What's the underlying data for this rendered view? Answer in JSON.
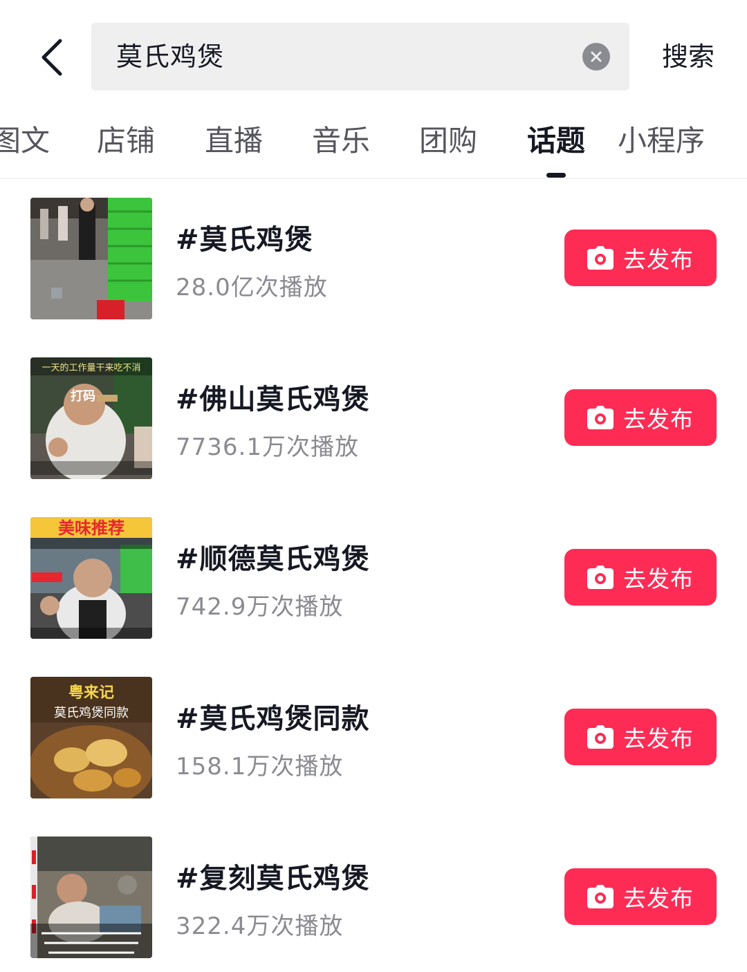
{
  "search": {
    "query": "莫氏鸡煲",
    "submit_label": "搜索"
  },
  "tabs": [
    {
      "label": "图文"
    },
    {
      "label": "店铺"
    },
    {
      "label": "直播"
    },
    {
      "label": "音乐"
    },
    {
      "label": "团购"
    },
    {
      "label": "话题",
      "active": true
    },
    {
      "label": "小程序"
    }
  ],
  "topics": [
    {
      "title": "#莫氏鸡煲",
      "plays": "28.0亿次播放",
      "action": "去发布"
    },
    {
      "title": "#佛山莫氏鸡煲",
      "plays": "7736.1万次播放",
      "action": "去发布"
    },
    {
      "title": "#顺德莫氏鸡煲",
      "plays": "742.9万次播放",
      "action": "去发布"
    },
    {
      "title": "#莫氏鸡煲同款",
      "plays": "158.1万次播放",
      "action": "去发布"
    },
    {
      "title": "#复刻莫氏鸡煲",
      "plays": "322.4万次播放",
      "action": "去发布"
    }
  ],
  "thumb_text": {
    "t2_top": "一天的工作量干来吃不消",
    "t2_mid": "打码",
    "t3_banner": "美味推荐",
    "t4_top": "粤来记",
    "t4_mid": "莫氏鸡煲同款"
  },
  "colors": {
    "accent": "#fe2c55",
    "text_primary": "#161823",
    "text_secondary": "#8a8b91",
    "search_bg": "#efeff0"
  },
  "icons": {
    "back": "chevron-left-icon",
    "clear": "close-circle-icon",
    "publish": "camera-icon"
  }
}
